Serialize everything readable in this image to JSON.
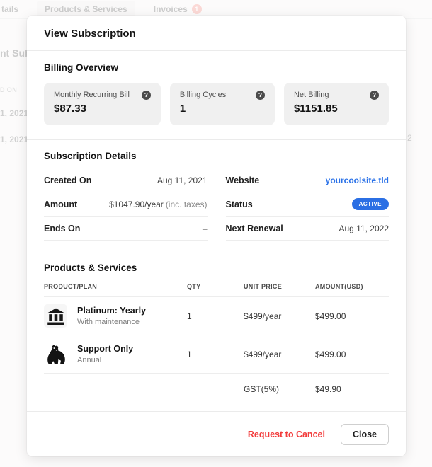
{
  "background": {
    "tab_fragment": "tails",
    "tab_products": "Products & Services",
    "tab_invoices": "Invoices",
    "invoices_badge": "1",
    "heading_fragment": "nt Subsc",
    "table_header_fragment": "D ON",
    "row_fragment_1": "1, 2021",
    "row_fragment_2": "1, 2021",
    "right_fragment": "2"
  },
  "icons": {
    "help": "?"
  },
  "colors": {
    "accent_blue": "#2b6fe4",
    "danger_red": "#f23b3b",
    "badge_red": "#ef6e63"
  },
  "modal": {
    "title": "View Subscription",
    "billing": {
      "heading": "Billing Overview",
      "cards": [
        {
          "label": "Monthly Recurring Bill",
          "value": "$87.33"
        },
        {
          "label": "Billing Cycles",
          "value": "1"
        },
        {
          "label": "Net Billing",
          "value": "$1151.85"
        }
      ]
    },
    "details": {
      "heading": "Subscription Details",
      "left": [
        {
          "label": "Created On",
          "value": "Aug 11, 2021"
        },
        {
          "label": "Amount",
          "value": "$1047.90/year",
          "note": "(inc. taxes)"
        },
        {
          "label": "Ends On",
          "value": "–"
        }
      ],
      "right": [
        {
          "label": "Website",
          "value": "yourcoolsite.tld"
        },
        {
          "label": "Status",
          "value": "ACTIVE"
        },
        {
          "label": "Next Renewal",
          "value": "Aug 11, 2022"
        }
      ]
    },
    "products": {
      "heading": "Products & Services",
      "columns": [
        "PRODUCT/PLAN",
        "QTY",
        "UNIT PRICE",
        "AMOUNT(USD)"
      ],
      "rows": [
        {
          "icon": "bank-icon",
          "title": "Platinum: Yearly",
          "subtitle": "With maintenance",
          "qty": "1",
          "unit_price": "$499/year",
          "amount": "$499.00"
        },
        {
          "icon": "gorilla-icon",
          "title": "Support Only",
          "subtitle": "Annual",
          "qty": "1",
          "unit_price": "$499/year",
          "amount": "$499.00"
        }
      ],
      "tax": {
        "label": "GST(5%)",
        "amount": "$49.90"
      }
    },
    "footer": {
      "cancel": "Request to Cancel",
      "close": "Close"
    }
  }
}
